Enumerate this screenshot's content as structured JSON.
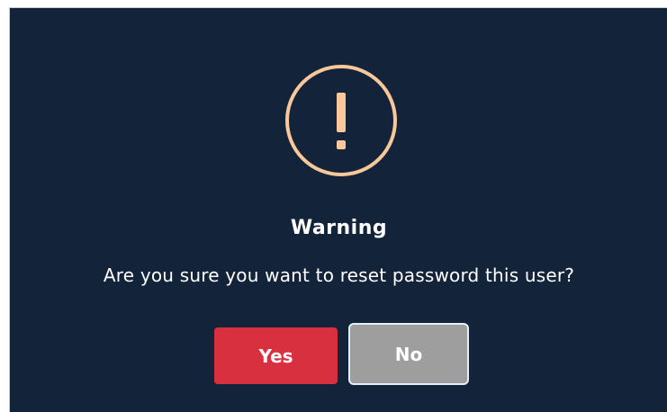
{
  "dialog": {
    "icon": "warning-exclamation-icon",
    "title": "Warning",
    "message": "Are you sure you want to reset password this user?",
    "yes_label": "Yes",
    "no_label": "No"
  },
  "colors": {
    "background": "#13233a",
    "icon": "#f8c79a",
    "yes_button": "#d9303f",
    "no_button": "#9e9e9e",
    "text": "#ffffff"
  }
}
